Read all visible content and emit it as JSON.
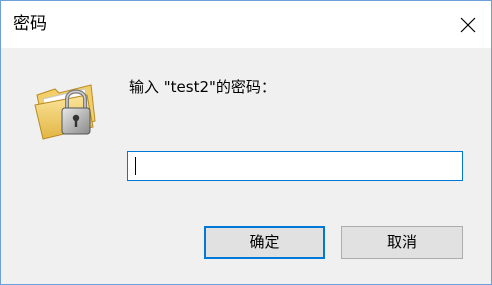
{
  "window": {
    "title": "密码",
    "close_icon": "close-icon"
  },
  "prompt": {
    "text": "输入 \"test2\"的密码："
  },
  "password": {
    "value": "",
    "placeholder": ""
  },
  "buttons": {
    "ok_label": "确定",
    "cancel_label": "取消"
  },
  "icon": {
    "name": "folder-lock-icon"
  },
  "colors": {
    "accent": "#0078d7",
    "background": "#f0f0f0",
    "titlebar": "#ffffff",
    "button": "#e1e1e1"
  }
}
